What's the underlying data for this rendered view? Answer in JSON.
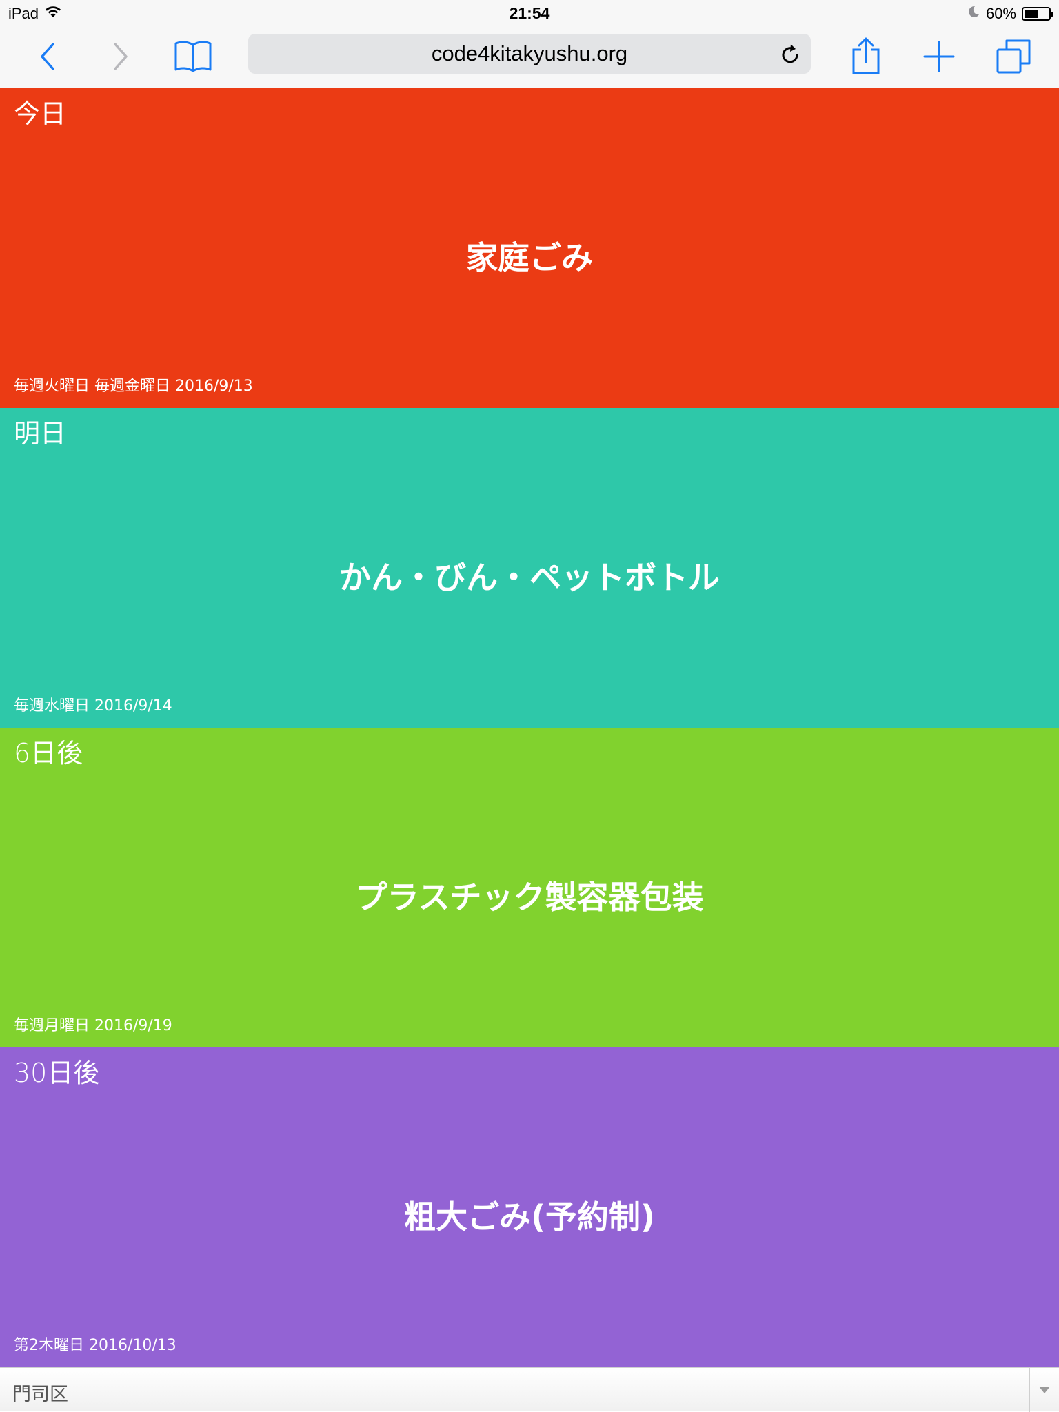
{
  "status_bar": {
    "device": "iPad",
    "time": "21:54",
    "battery_percent_label": "60%",
    "battery_level": 0.6
  },
  "browser": {
    "url": "code4kitakyushu.org",
    "accent_color": "#1a7cf5"
  },
  "panels": [
    {
      "when": "今日",
      "title": "家庭ごみ",
      "schedule": "毎週火曜日 毎週金曜日 2016/9/13",
      "color": "#eb3b14"
    },
    {
      "when": "明日",
      "title": "かん・びん・ペットボトル",
      "schedule": "毎週水曜日 2016/9/14",
      "color": "#2ec8a9"
    },
    {
      "when": "6日後",
      "title": "プラスチック製容器包装",
      "schedule": "毎週月曜日 2016/9/19",
      "color": "#81d22e"
    },
    {
      "when": "30日後",
      "title": "粗大ごみ(予約制)",
      "schedule": "第2木曜日 2016/10/13",
      "color": "#9363d4"
    }
  ],
  "area_select": {
    "selected": "門司区"
  }
}
